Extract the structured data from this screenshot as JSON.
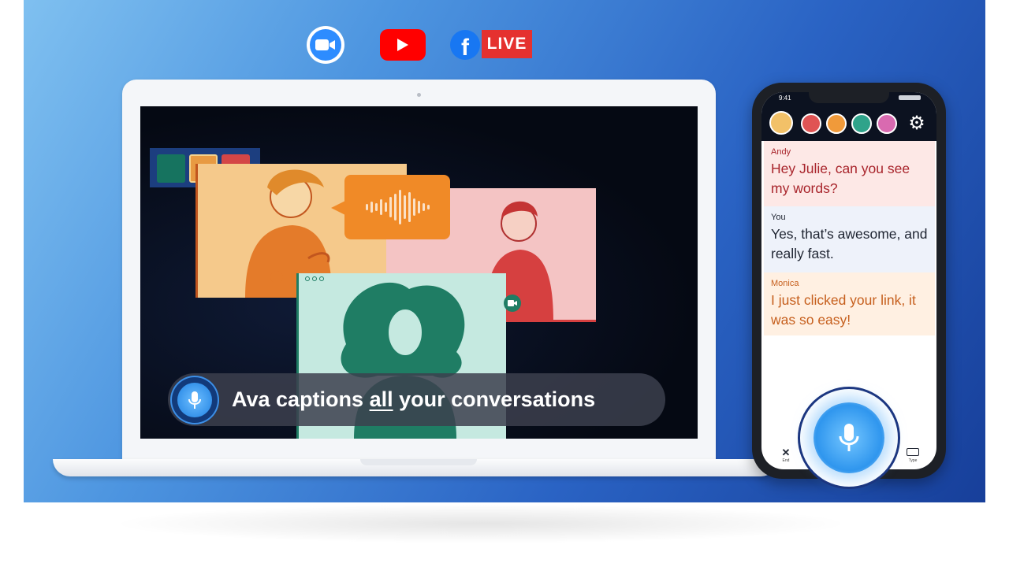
{
  "platforms": {
    "items": [
      {
        "name": "zoom-icon"
      },
      {
        "name": "youtube-icon"
      },
      {
        "name": "facebook-icon"
      }
    ],
    "facebook_letter": "f",
    "live_label": "LIVE",
    "colors": {
      "zoom": "#2d8cff",
      "youtube": "#ff0000",
      "facebook": "#1877f2",
      "live": "#e5312f"
    }
  },
  "laptop": {
    "caption": {
      "before": "Ava captions ",
      "emphasis": "all",
      "after": " your conversations"
    }
  },
  "phone": {
    "status_time": "9:41",
    "settings_icon": "gear-icon",
    "messages": [
      {
        "speaker": "Andy",
        "text": "Hey Julie, can you see my words?",
        "color": "#a8242b"
      },
      {
        "speaker": "You",
        "text": "Yes, that’s awesome, and really fast.",
        "color": "#1e2431"
      },
      {
        "speaker": "Monica",
        "text": "I just clicked your link, it was so easy!",
        "color": "#c65f1d"
      }
    ],
    "bottom": {
      "end_label": "End",
      "type_label": "Type"
    }
  },
  "colors": {
    "brand_blue": "#2a63c4",
    "mic_blue": "#2f96ee"
  }
}
